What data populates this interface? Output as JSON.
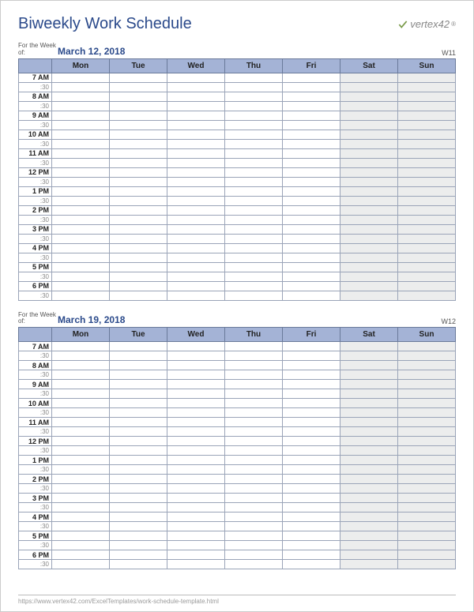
{
  "title": "Biweekly Work Schedule",
  "brand": "vertex42",
  "weekOfLabel": "For the Week of:",
  "days": [
    "Mon",
    "Tue",
    "Wed",
    "Thu",
    "Fri",
    "Sat",
    "Sun"
  ],
  "weekendIndices": [
    5,
    6
  ],
  "timeRows": [
    {
      "label": "7 AM",
      "half": false
    },
    {
      "label": ":30",
      "half": true
    },
    {
      "label": "8 AM",
      "half": false
    },
    {
      "label": ":30",
      "half": true
    },
    {
      "label": "9 AM",
      "half": false
    },
    {
      "label": ":30",
      "half": true
    },
    {
      "label": "10 AM",
      "half": false
    },
    {
      "label": ":30",
      "half": true
    },
    {
      "label": "11 AM",
      "half": false
    },
    {
      "label": ":30",
      "half": true
    },
    {
      "label": "12 PM",
      "half": false
    },
    {
      "label": ":30",
      "half": true
    },
    {
      "label": "1 PM",
      "half": false
    },
    {
      "label": ":30",
      "half": true
    },
    {
      "label": "2 PM",
      "half": false
    },
    {
      "label": ":30",
      "half": true
    },
    {
      "label": "3 PM",
      "half": false
    },
    {
      "label": ":30",
      "half": true
    },
    {
      "label": "4 PM",
      "half": false
    },
    {
      "label": ":30",
      "half": true
    },
    {
      "label": "5 PM",
      "half": false
    },
    {
      "label": ":30",
      "half": true
    },
    {
      "label": "6 PM",
      "half": false
    },
    {
      "label": ":30",
      "half": true
    }
  ],
  "weeks": [
    {
      "date": "March 12, 2018",
      "weekNum": "W11"
    },
    {
      "date": "March 19, 2018",
      "weekNum": "W12"
    }
  ],
  "footer": "https://www.vertex42.com/ExcelTemplates/work-schedule-template.html"
}
